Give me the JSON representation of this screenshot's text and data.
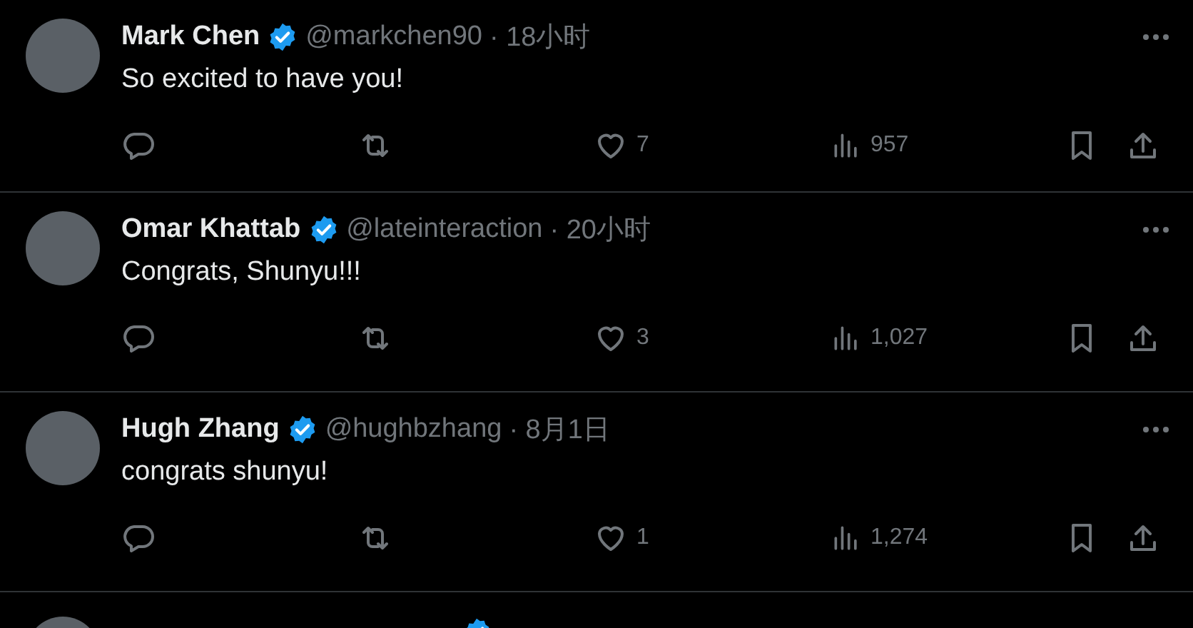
{
  "tweets": [
    {
      "kind": "full",
      "name": "Mark Chen",
      "verified": true,
      "handle": "@markchen90",
      "time": "· 18小时",
      "text": "So excited to have you!",
      "likes": "7",
      "views": "957"
    },
    {
      "kind": "full",
      "name": "Omar Khattab",
      "verified": true,
      "handle": "@lateinteraction",
      "time": "· 20小时",
      "text": "Congrats, Shunyu!!!",
      "likes": "3",
      "views": "1,027"
    },
    {
      "kind": "full",
      "name": "Hugh Zhang",
      "verified": true,
      "handle": "@hughbzhang",
      "time": "· 8月1日",
      "text": "congrats shunyu!",
      "likes": "1",
      "views": "1,274"
    },
    {
      "kind": "partial",
      "verified": true
    }
  ]
}
